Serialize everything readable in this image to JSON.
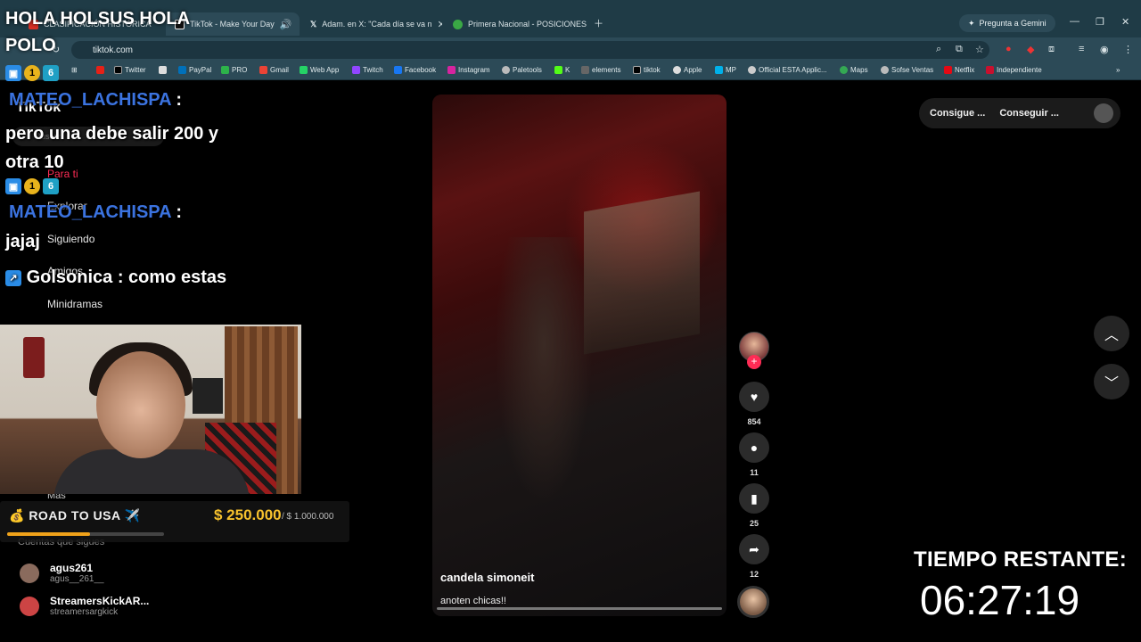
{
  "browser": {
    "tabs": [
      {
        "label": "CLASIFICACIÓN HISTÓRICA",
        "color": "#d93025"
      },
      {
        "label": "TikTok - Make Your Day",
        "color": "#111111"
      },
      {
        "label": "Adam. en X: \"Cada día se va n",
        "color": "#000000"
      },
      {
        "label": "Primera Nacional - POSICIONES",
        "color": "#3aa845"
      }
    ],
    "gemini": "Pregunta a Gemini",
    "url": "tiktok.com",
    "bookmarks": [
      "Twitter",
      "PayPal",
      "PRO",
      "Gmail",
      "Web App",
      "Twitch",
      "Facebook",
      "Instagram",
      "Paletools",
      "K",
      "elements",
      "tiktok",
      "Apple",
      "MP",
      "Official ESTA Applic...",
      "Maps",
      "Sofse Ventas",
      "Netflix",
      "Independiente"
    ]
  },
  "tiktok": {
    "logo": "TikTok",
    "search_placeholder": "Buscar",
    "nav": [
      "Para ti",
      "Explorar",
      "Siguiendo",
      "Amigos",
      "Minidramas"
    ],
    "more": "Más",
    "following_title": "Cuentas que sigues",
    "accounts": [
      {
        "name": "agus261",
        "handle": "agus__261__"
      },
      {
        "name": "StreamersKickAR...",
        "handle": "streamersargkick"
      }
    ],
    "top_right": [
      "Consigue ...",
      "Conseguir ..."
    ],
    "video": {
      "author": "candela simoneit",
      "caption": "anoten chicas!!",
      "likes": "854",
      "comments": "11",
      "saves": "25",
      "shares": "12"
    }
  },
  "overlay": {
    "headline": "HOLA HOLSUS HOLA",
    "headline2": "POLO",
    "chat": [
      {
        "user": "MATEO_LACHISPA",
        "text": "pero una debe salir 200 y otra 10"
      },
      {
        "user": "MATEO_LACHISPA",
        "text": "jajaj"
      },
      {
        "user": "Golsonica",
        "text": "como estas"
      }
    ],
    "goal": {
      "title": "💰 ROAD TO USA ✈️",
      "current": "$ 250.000",
      "total": "/ $ 1.000.000",
      "progress": 0.53
    },
    "timer_label": "TIEMPO RESTANTE:",
    "timer": "06:27:19"
  }
}
